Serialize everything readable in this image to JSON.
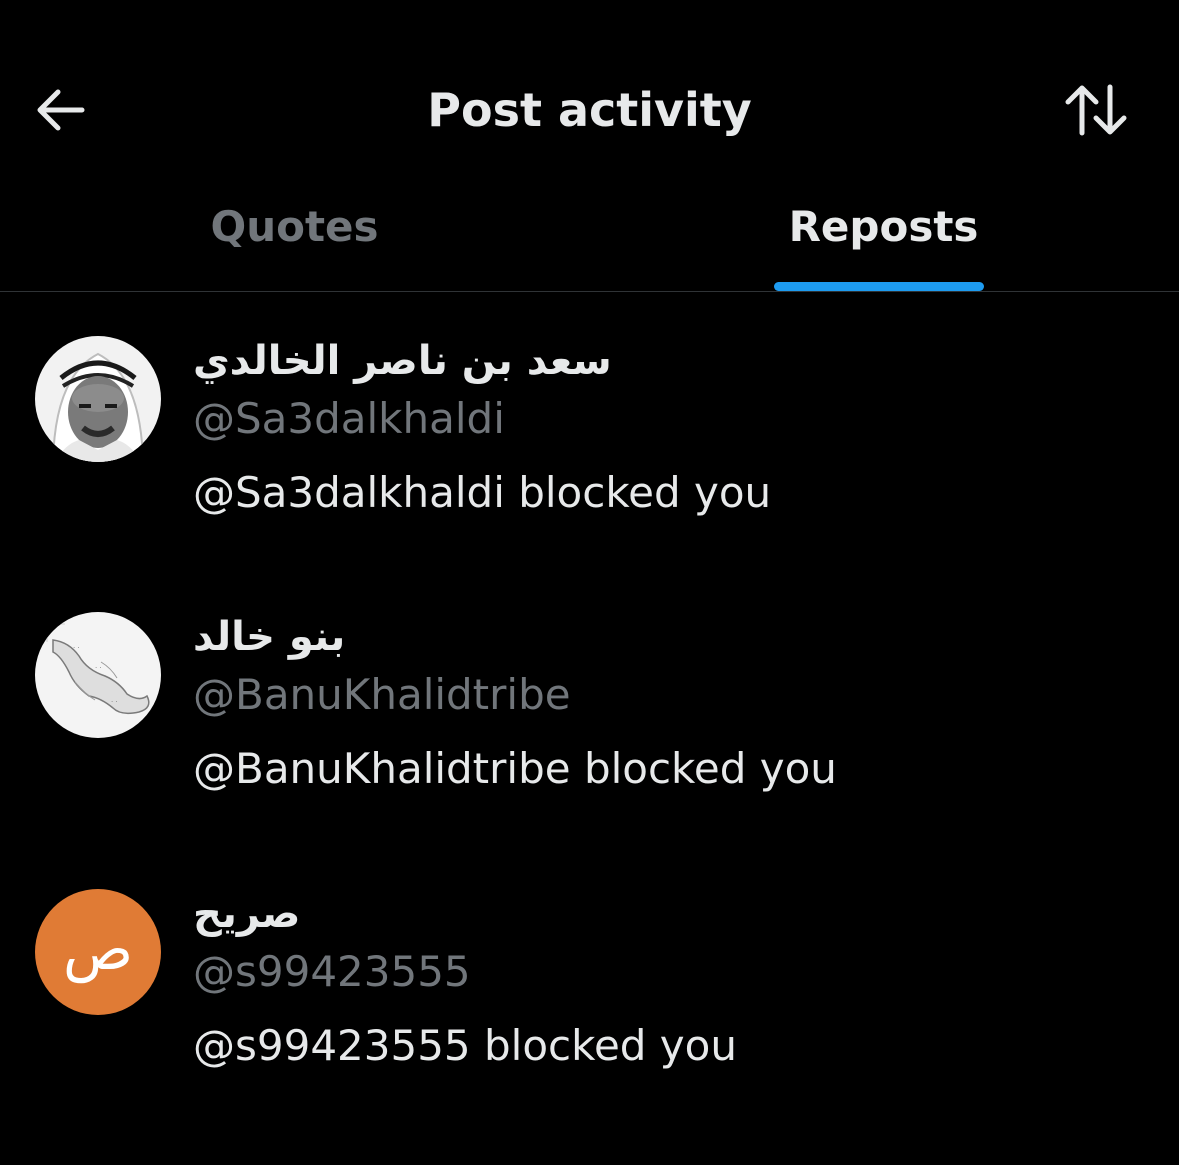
{
  "header": {
    "title": "Post activity",
    "back_icon": "arrow-left-icon",
    "sort_icon": "sort-arrows-icon"
  },
  "tabs": [
    {
      "label": "Quotes",
      "active": false
    },
    {
      "label": "Reposts",
      "active": true
    }
  ],
  "colors": {
    "background": "#000000",
    "primary_text": "#e7e9ea",
    "secondary_text": "#71767b",
    "accent": "#1d9bf0",
    "divider": "#2f3336",
    "orange_avatar": "#e07b35"
  },
  "users": [
    {
      "display_name": "سعد بن ناصر الخالدي",
      "handle": "@Sa3dalkhaldi",
      "status": "@Sa3dalkhaldi blocked you",
      "avatar": "photo-avatar"
    },
    {
      "display_name": "بنو خالد",
      "handle": "@BanuKhalidtribe",
      "status": "@BanuKhalidtribe blocked you",
      "avatar": "map-avatar"
    },
    {
      "display_name": "صريح",
      "handle": "@s99423555",
      "status": "@s99423555 blocked you",
      "avatar": "letter-avatar",
      "avatar_letter": "ص"
    }
  ]
}
